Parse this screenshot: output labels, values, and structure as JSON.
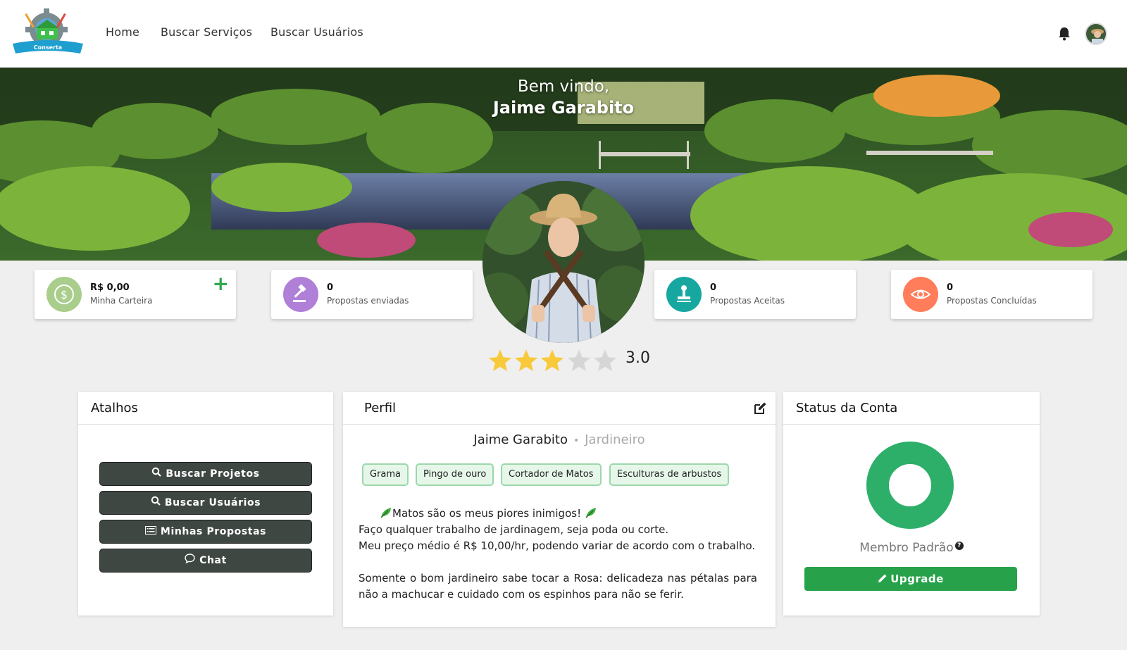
{
  "navbar": {
    "logo_text": "Conserta",
    "links": [
      "Home",
      "Buscar Serviços",
      "Buscar Usuários"
    ]
  },
  "banner": {
    "welcome_line1": "Bem vindo,",
    "welcome_line2": "Jaime Garabito"
  },
  "stats": [
    {
      "value": "R$ 0,00",
      "label": "Minha Carteira",
      "icon": "dollar-icon",
      "color": "#a9cd8b"
    },
    {
      "value": "0",
      "label": "Propostas enviadas",
      "icon": "gavel-icon",
      "color": "#b07fd8"
    },
    {
      "value": "0",
      "label": "Propostas Aceitas",
      "icon": "stamp-icon",
      "color": "#17a7a1"
    },
    {
      "value": "0",
      "label": "Propostas Concluídas",
      "icon": "eye-icon",
      "color": "#ff7d5a"
    }
  ],
  "rating": {
    "value": "3.0",
    "stars_filled": 3,
    "stars_total": 5,
    "star_color": "#f8c93b",
    "empty_color": "#d6d6d6"
  },
  "shortcuts": {
    "title": "Atalhos",
    "buttons": [
      {
        "label": "Buscar Projetos",
        "icon": "search-icon"
      },
      {
        "label": "Buscar Usuários",
        "icon": "search-icon"
      },
      {
        "label": "Minhas Propostas",
        "icon": "list-icon"
      },
      {
        "label": "Chat",
        "icon": "chat-icon"
      }
    ]
  },
  "profile": {
    "title": "Perfil",
    "name": "Jaime Garabito",
    "profession": "Jardineiro",
    "tags": [
      "Grama",
      "Pingo de ouro",
      "Cortador de Matos",
      "Esculturas de arbustos"
    ],
    "bio_line1": "Matos são os meus piores inimigos!",
    "bio_line2": "Faço qualquer trabalho de jardinagem, seja poda ou corte.",
    "bio_line3": "Meu preço médio é R$ 10,00/hr, podendo variar de acordo com o trabalho.",
    "bio_line4": "Somente o bom jardineiro sabe tocar a Rosa: delicadeza nas pétalas para não a machucar e cuidado com os espinhos para não se ferir."
  },
  "account": {
    "title": "Status da Conta",
    "membership": "Membro Padrão",
    "help_glyph": "?",
    "upgrade_label": "Upgrade",
    "accent": "#2daf6a"
  }
}
